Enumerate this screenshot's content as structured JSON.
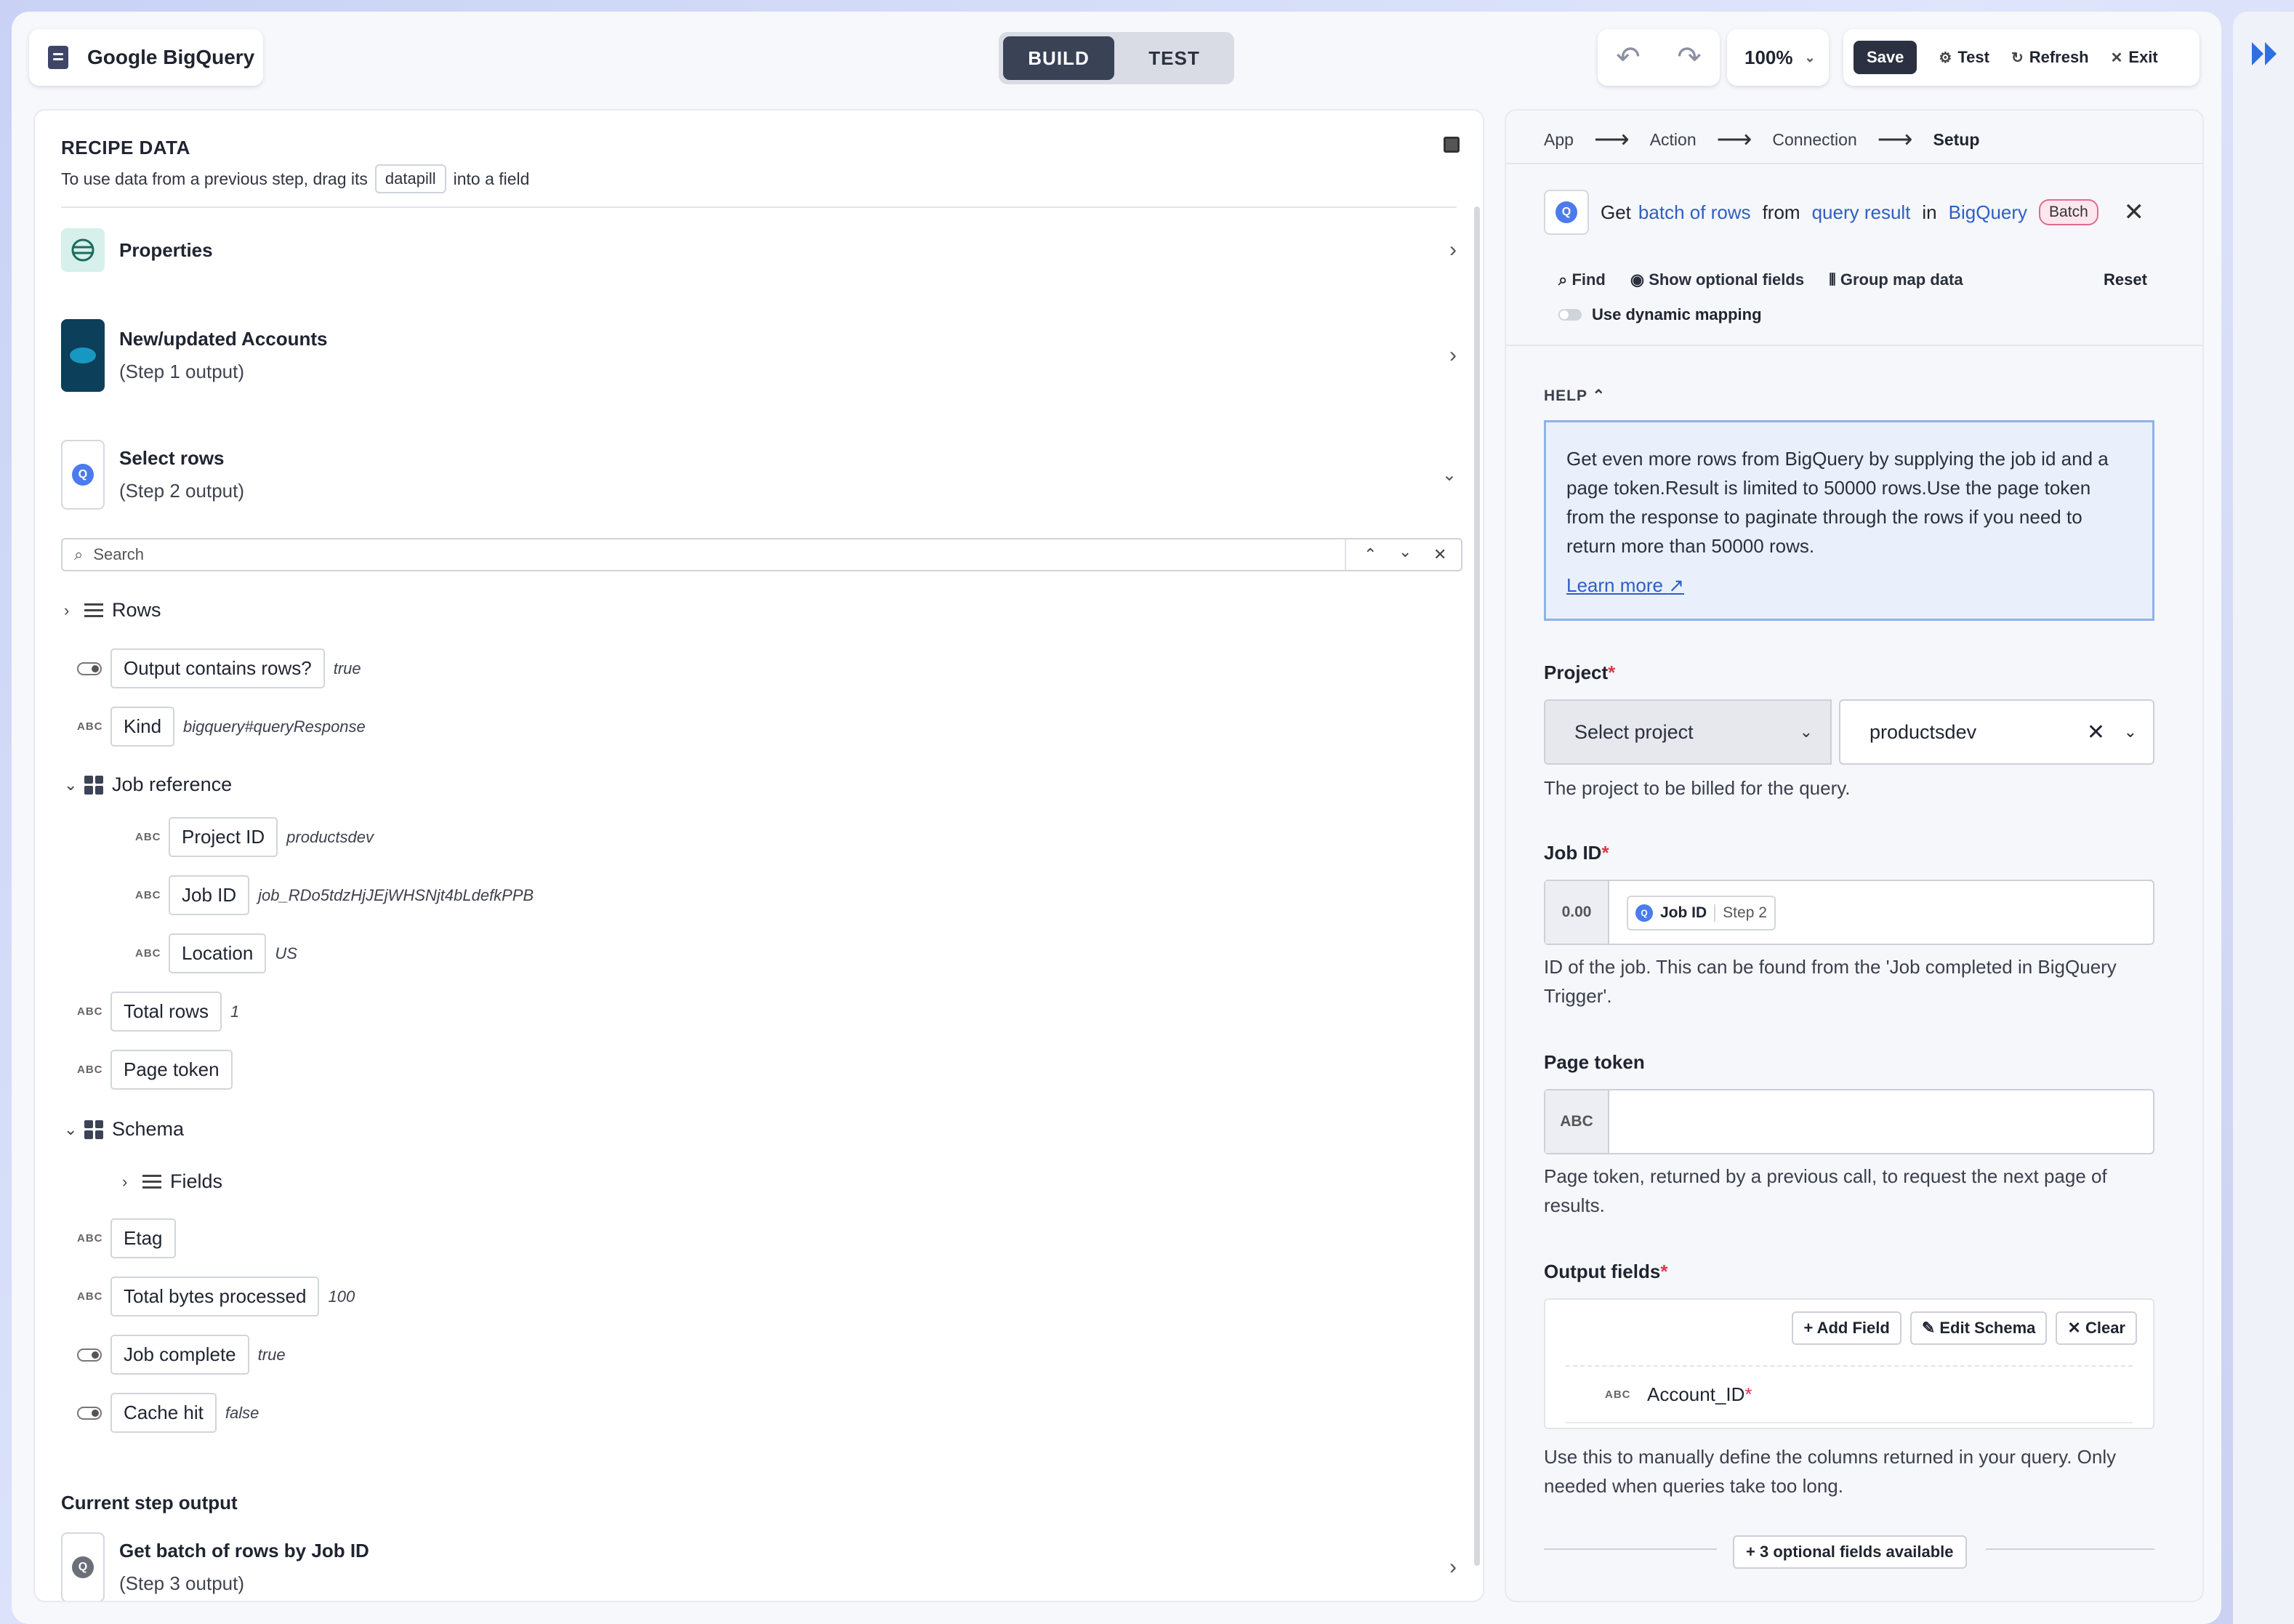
{
  "app": {
    "title": "Google BigQuery"
  },
  "mode_tabs": {
    "build": "BUILD",
    "test": "TEST",
    "active": "build"
  },
  "toolbar": {
    "zoom": "100%",
    "save": "Save",
    "test": "Test",
    "refresh": "Refresh",
    "exit": "Exit"
  },
  "recipe_data": {
    "title": "RECIPE DATA",
    "hint_before": "To use data from a previous step, drag its",
    "hint_pill": "datapill",
    "hint_after": "into a field",
    "sections": [
      {
        "title": "Properties",
        "subtitle": ""
      },
      {
        "title": "New/updated Accounts",
        "subtitle": "(Step 1 output)"
      },
      {
        "title": "Select rows",
        "subtitle": "(Step 2 output)"
      }
    ],
    "search_placeholder": "Search",
    "tree": {
      "rows": "Rows",
      "output_contains_rows": {
        "label": "Output contains rows?",
        "value": "true"
      },
      "kind": {
        "badge": "ABC",
        "label": "Kind",
        "value": "bigquery#queryResponse"
      },
      "job_reference": "Job reference",
      "project_id": {
        "badge": "ABC",
        "label": "Project ID",
        "value": "productsdev"
      },
      "job_id": {
        "badge": "ABC",
        "label": "Job ID",
        "value": "job_RDo5tdzHjJEjWHSNjt4bLdefkPPB"
      },
      "location": {
        "badge": "ABC",
        "label": "Location",
        "value": "US"
      },
      "total_rows": {
        "badge": "ABC",
        "label": "Total rows",
        "value": "1"
      },
      "page_token": {
        "badge": "ABC",
        "label": "Page token"
      },
      "schema": "Schema",
      "fields": "Fields",
      "etag": {
        "badge": "ABC",
        "label": "Etag"
      },
      "total_bytes": {
        "badge": "ABC",
        "label": "Total bytes processed",
        "value": "100"
      },
      "job_complete": {
        "label": "Job complete",
        "value": "true"
      },
      "cache_hit": {
        "label": "Cache hit",
        "value": "false"
      }
    },
    "current_step_output": "Current step output",
    "current_step": {
      "title": "Get batch of rows by Job ID",
      "subtitle": "(Step 3 output)"
    }
  },
  "setup": {
    "crumbs": [
      "App",
      "Action",
      "Connection",
      "Setup"
    ],
    "action": {
      "pre": "Get",
      "link1": "batch of rows",
      "mid1": "from",
      "link2": "query result",
      "mid2": "in",
      "link3": "BigQuery",
      "badge": "Batch"
    },
    "options": {
      "find": "Find",
      "optional": "Show optional fields",
      "group": "Group map data",
      "reset": "Reset",
      "dynamic": "Use dynamic mapping"
    },
    "help_label": "HELP",
    "help_text": "Get even more rows from BigQuery by supplying the job id and a page token.Result is limited to 50000 rows.Use the page token from the response to paginate through the rows if you need to return more than 50000 rows.",
    "learn_more": "Learn more",
    "project": {
      "label": "Project",
      "select_label": "Select project",
      "value": "productsdev",
      "hint": "The project to be billed for the query."
    },
    "job_id": {
      "label": "Job ID",
      "prefix": "0.00",
      "pill_label": "Job ID",
      "pill_step": "Step 2",
      "hint": "ID of the job. This can be found from the 'Job completed in BigQuery Trigger'."
    },
    "page_token": {
      "label": "Page token",
      "prefix": "ABC",
      "hint": "Page token, returned by a previous call, to request the next page of results."
    },
    "output_fields": {
      "label": "Output fields",
      "add": "Add Field",
      "edit": "Edit Schema",
      "clear": "Clear",
      "field_badge": "ABC",
      "field_name": "Account_ID",
      "hint": "Use this to manually define the columns returned in your query. Only needed when queries take too long."
    },
    "optional_available": "3 optional fields available"
  }
}
